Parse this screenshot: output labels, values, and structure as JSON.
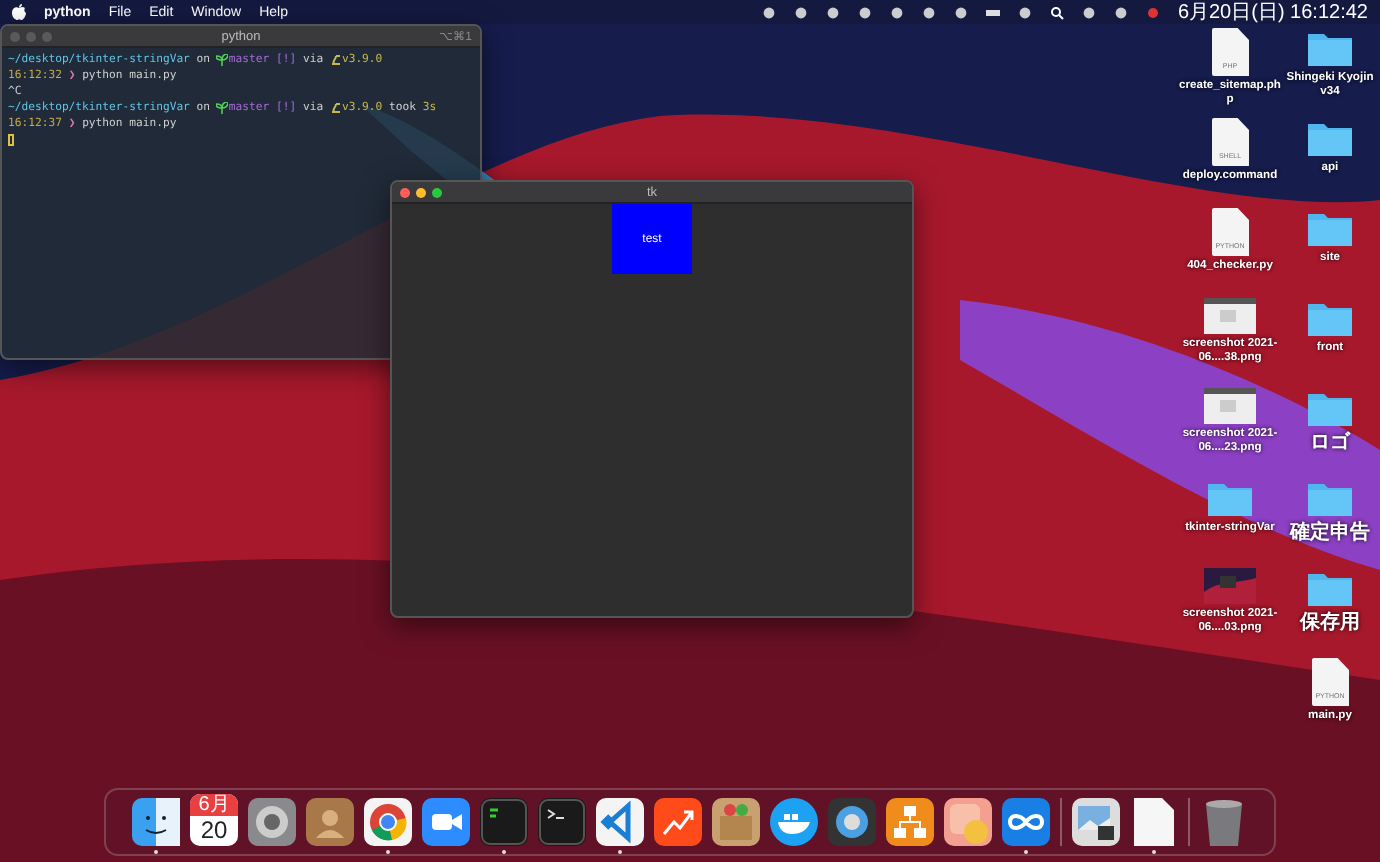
{
  "menu_bar": {
    "app": "python",
    "items": [
      "File",
      "Edit",
      "Window",
      "Help"
    ],
    "clock": "6月20日(日)  16:12:42"
  },
  "terminal": {
    "title": "python",
    "shortcut": "⌥⌘1",
    "active": false,
    "lines": [
      {
        "segments": [
          {
            "kind": "path",
            "text": "~/desktop/tkinter-stringVar"
          },
          {
            "kind": "plain",
            "text": " on "
          },
          {
            "kind": "sprout"
          },
          {
            "kind": "branch",
            "text": "master [!]"
          },
          {
            "kind": "plain",
            "text": " via "
          },
          {
            "kind": "snake"
          },
          {
            "kind": "version",
            "text": "v3.9.0"
          }
        ]
      },
      {
        "segments": [
          {
            "kind": "time",
            "text": "16:12:32"
          },
          {
            "kind": "prompt",
            "text": " ❯ "
          },
          {
            "kind": "plain",
            "text": "python main.py"
          }
        ]
      },
      {
        "segments": [
          {
            "kind": "plain",
            "text": "^C"
          }
        ]
      },
      {
        "segments": [
          {
            "kind": "path",
            "text": "~/desktop/tkinter-stringVar"
          },
          {
            "kind": "plain",
            "text": " on "
          },
          {
            "kind": "sprout"
          },
          {
            "kind": "branch",
            "text": "master [!]"
          },
          {
            "kind": "plain",
            "text": " via "
          },
          {
            "kind": "snake"
          },
          {
            "kind": "version",
            "text": "v3.9.0"
          },
          {
            "kind": "plain",
            "text": " took "
          },
          {
            "kind": "version",
            "text": "3s"
          }
        ]
      },
      {
        "segments": [
          {
            "kind": "time",
            "text": "16:12:37"
          },
          {
            "kind": "prompt",
            "text": " ❯ "
          },
          {
            "kind": "plain",
            "text": "python main.py"
          }
        ]
      },
      {
        "segments": [
          {
            "kind": "cursor"
          }
        ]
      }
    ]
  },
  "tk_window": {
    "title": "tk",
    "active": true,
    "label": "test"
  },
  "desktop_icons": [
    [
      {
        "kind": "file",
        "badge": "PHP",
        "label": "create_sitemap.php"
      },
      {
        "kind": "file",
        "badge": "SHELL",
        "label": "deploy.command"
      },
      {
        "kind": "file",
        "badge": "PYTHON",
        "label": "404_checker.py"
      },
      {
        "kind": "screenshot",
        "label": "screenshot 2021-06....38.png"
      },
      {
        "kind": "screenshot",
        "label": "screenshot 2021-06....23.png"
      },
      {
        "kind": "folder",
        "label": "tkinter-stringVar"
      },
      {
        "kind": "screenshot-dark",
        "label": "screenshot 2021-06....03.png"
      }
    ],
    [
      {
        "kind": "folder",
        "label": "Shingeki Kyojin v34"
      },
      {
        "kind": "folder",
        "label": "api"
      },
      {
        "kind": "folder",
        "label": "site"
      },
      {
        "kind": "folder",
        "label": "front"
      },
      {
        "kind": "folder",
        "label": "ロゴ"
      },
      {
        "kind": "folder",
        "label": "確定申告"
      },
      {
        "kind": "folder",
        "label": "保存用"
      },
      {
        "kind": "file",
        "badge": "PYTHON",
        "label": "main.py"
      }
    ]
  ],
  "dock": [
    {
      "kind": "finder",
      "running": true
    },
    {
      "kind": "calendar",
      "running": false,
      "month": "6月",
      "day": "20"
    },
    {
      "kind": "settings",
      "running": false
    },
    {
      "kind": "contacts",
      "running": false
    },
    {
      "kind": "browser",
      "running": true
    },
    {
      "kind": "video",
      "running": false
    },
    {
      "kind": "terminal-green",
      "running": true
    },
    {
      "kind": "terminal",
      "running": false
    },
    {
      "kind": "code",
      "running": true
    },
    {
      "kind": "chart",
      "running": false
    },
    {
      "kind": "box",
      "running": false
    },
    {
      "kind": "whale",
      "running": false
    },
    {
      "kind": "player",
      "running": false
    },
    {
      "kind": "diagram",
      "running": false
    },
    {
      "kind": "pill",
      "running": false
    },
    {
      "kind": "infinity",
      "running": true
    },
    {
      "kind": "separator"
    },
    {
      "kind": "preview",
      "running": false
    },
    {
      "kind": "document",
      "running": true
    },
    {
      "kind": "separator"
    },
    {
      "kind": "trash",
      "running": false
    }
  ]
}
